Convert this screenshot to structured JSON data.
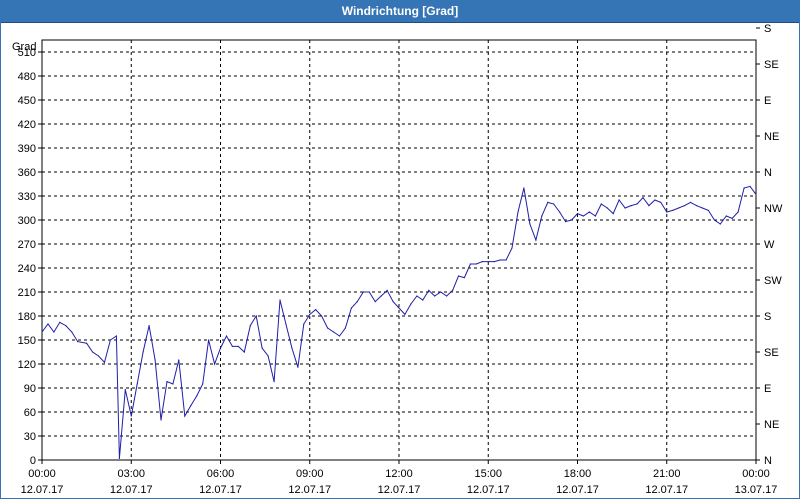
{
  "window": {
    "title": "Windrichtung [Grad]"
  },
  "chart_data": {
    "type": "line",
    "title": "Windrichtung [Grad]",
    "ylabel": "Grad",
    "ylim": [
      0,
      525
    ],
    "xlim": [
      "12.07.17 00:00",
      "13.07.17 00:00"
    ],
    "y_ticks": [
      0,
      30,
      60,
      90,
      120,
      150,
      180,
      210,
      240,
      270,
      300,
      330,
      360,
      390,
      420,
      450,
      480,
      510
    ],
    "x_ticks": [
      {
        "time": "00:00",
        "date": "12.07.17"
      },
      {
        "time": "03:00",
        "date": "12.07.17"
      },
      {
        "time": "06:00",
        "date": "12.07.17"
      },
      {
        "time": "09:00",
        "date": "12.07.17"
      },
      {
        "time": "12:00",
        "date": "12.07.17"
      },
      {
        "time": "15:00",
        "date": "12.07.17"
      },
      {
        "time": "18:00",
        "date": "12.07.17"
      },
      {
        "time": "21:00",
        "date": "12.07.17"
      },
      {
        "time": "00:00",
        "date": "13.07.17"
      }
    ],
    "right_axis_labels": [
      {
        "deg": 0,
        "label": "N"
      },
      {
        "deg": 45,
        "label": "NE"
      },
      {
        "deg": 90,
        "label": "E"
      },
      {
        "deg": 135,
        "label": "SE"
      },
      {
        "deg": 180,
        "label": "S"
      },
      {
        "deg": 225,
        "label": "SW"
      },
      {
        "deg": 270,
        "label": "W"
      },
      {
        "deg": 315,
        "label": "NW"
      },
      {
        "deg": 360,
        "label": "N"
      },
      {
        "deg": 405,
        "label": "NE"
      },
      {
        "deg": 450,
        "label": "E"
      },
      {
        "deg": 495,
        "label": "SE"
      },
      {
        "deg": 540,
        "label": "S"
      }
    ],
    "grid": true,
    "line_color": "#1f1fa8",
    "series": [
      {
        "x_hours": [
          0.0,
          0.2,
          0.4,
          0.6,
          0.8,
          1.0,
          1.2,
          1.5,
          1.7,
          1.9,
          2.1,
          2.3,
          2.5,
          2.6,
          2.8,
          3.0,
          3.2,
          3.4,
          3.6,
          3.8,
          4.0,
          4.2,
          4.4,
          4.6,
          4.8,
          5.0,
          5.2,
          5.4,
          5.6,
          5.8,
          6.0,
          6.2,
          6.4,
          6.6,
          6.8,
          7.0,
          7.2,
          7.4,
          7.6,
          7.8,
          8.0,
          8.2,
          8.4,
          8.6,
          8.8,
          9.0,
          9.2,
          9.4,
          9.6,
          9.8,
          10.0,
          10.2,
          10.4,
          10.6,
          10.8,
          11.0,
          11.2,
          11.4,
          11.6,
          11.8,
          12.0,
          12.2,
          12.4,
          12.6,
          12.8,
          13.0,
          13.2,
          13.4,
          13.6,
          13.8,
          14.0,
          14.2,
          14.4,
          14.6,
          14.8,
          15.0,
          15.2,
          15.4,
          15.6,
          15.8,
          16.0,
          16.2,
          16.4,
          16.6,
          16.8,
          17.0,
          17.2,
          17.4,
          17.6,
          17.8,
          18.0,
          18.2,
          18.4,
          18.6,
          18.8,
          19.0,
          19.2,
          19.4,
          19.6,
          19.8,
          20.0,
          20.2,
          20.4,
          20.6,
          20.8,
          21.0,
          21.2,
          21.4,
          21.6,
          21.8,
          22.0,
          22.2,
          22.4,
          22.6,
          22.8,
          23.0,
          23.2,
          23.4,
          23.6,
          23.8,
          24.0
        ],
        "y_deg": [
          160,
          170,
          160,
          172,
          168,
          160,
          148,
          146,
          135,
          130,
          122,
          150,
          155,
          2,
          88,
          55,
          95,
          135,
          168,
          125,
          50,
          98,
          95,
          125,
          55,
          68,
          80,
          95,
          150,
          120,
          140,
          155,
          142,
          142,
          135,
          168,
          180,
          140,
          130,
          98,
          200,
          170,
          140,
          116,
          170,
          182,
          188,
          180,
          165,
          160,
          155,
          165,
          190,
          198,
          210,
          210,
          198,
          205,
          212,
          198,
          190,
          182,
          195,
          205,
          200,
          212,
          205,
          210,
          205,
          212,
          230,
          228,
          245,
          245,
          248,
          248,
          248,
          250,
          250,
          265,
          310,
          340,
          295,
          275,
          305,
          322,
          320,
          310,
          298,
          300,
          308,
          305,
          310,
          305,
          320,
          315,
          308,
          325,
          315,
          318,
          320,
          328,
          318,
          325,
          322,
          310,
          312,
          315,
          318,
          322,
          318,
          315,
          312,
          300,
          295,
          305,
          302,
          310,
          340,
          342,
          332
        ]
      }
    ]
  }
}
